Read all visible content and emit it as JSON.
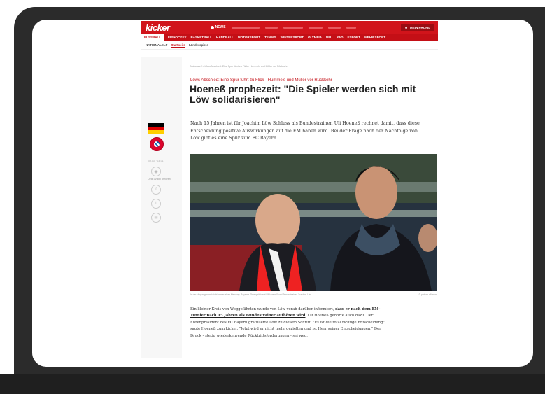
{
  "header": {
    "logo": "kicker",
    "news_label": "NEWS",
    "profile_label": "MEIN PROFIL",
    "nav_items": [
      "FUSSBALL",
      "EISHOCKEY",
      "BASKETBALL",
      "HANDBALL",
      "MOTORSPORT",
      "TENNIS",
      "WINTERSPORT",
      "OLYMPIA",
      "NFL",
      "RAD",
      "ESPORT",
      "MEHR SPORT"
    ],
    "sub_items": [
      "NATIONALELF",
      "Startseite",
      "Länderspiele"
    ]
  },
  "article": {
    "breadcrumb": "Nationalelf > Löws Abschied: Eine Spur führt zu Flick - Hummels und Müller vor Rückkehr",
    "kicker_line": "Löws Abschied: Eine Spur führt zu Flick - Hummels und Müller vor Rückkehr",
    "headline": "Hoeneß prophezeit: \"Die Spieler werden sich mit Löw solidarisieren\"",
    "lead": "Nach 15 Jahren ist für Joachim Löw Schluss als Bundestrainer. Uli Hoeneß rechnet damit, dass diese Entscheidung positive Auswirkungen auf die EM haben wird. Bei der Frage nach der Nachfolge von Löw gibt es eine Spur zum FC Bayern.",
    "photo_caption": "In der Vergangenheit nicht immer einer Meinung: Bayerns Ehrenpräsident Uli Hoeneß und Bundestrainer Joachim Löw.",
    "photo_credit": "© picture alliance",
    "body_before_link": "Ein kleiner Kreis von Weggefährten wurde von Löw vorab darüber informiert, ",
    "body_link": "dass er nach dem EM-Turnier nach 15 Jahren als Bundestrainer aufhören wird",
    "body_after_link": ". Uli Hoeneß gehörte auch dazu. Der Ehrenpräsident des FC Bayern gratulierte Löw zu diesem Schritt. \"Es ist die total richtige Entscheidung\", sagte Hoeneß zum kicker. \"Jetzt wird er nicht mehr gezielten und ist Herr seiner Entscheidungen.\" Der Druck - stetig wiederkehrende Rücktrittsforderungen - sei weg."
  },
  "sidebar": {
    "date": "09.03. · 18:31",
    "comment_label": "Jetzt Artikel anhören"
  },
  "colors": {
    "brand_red": "#d1141b",
    "device_frame": "#2b2b2b"
  }
}
